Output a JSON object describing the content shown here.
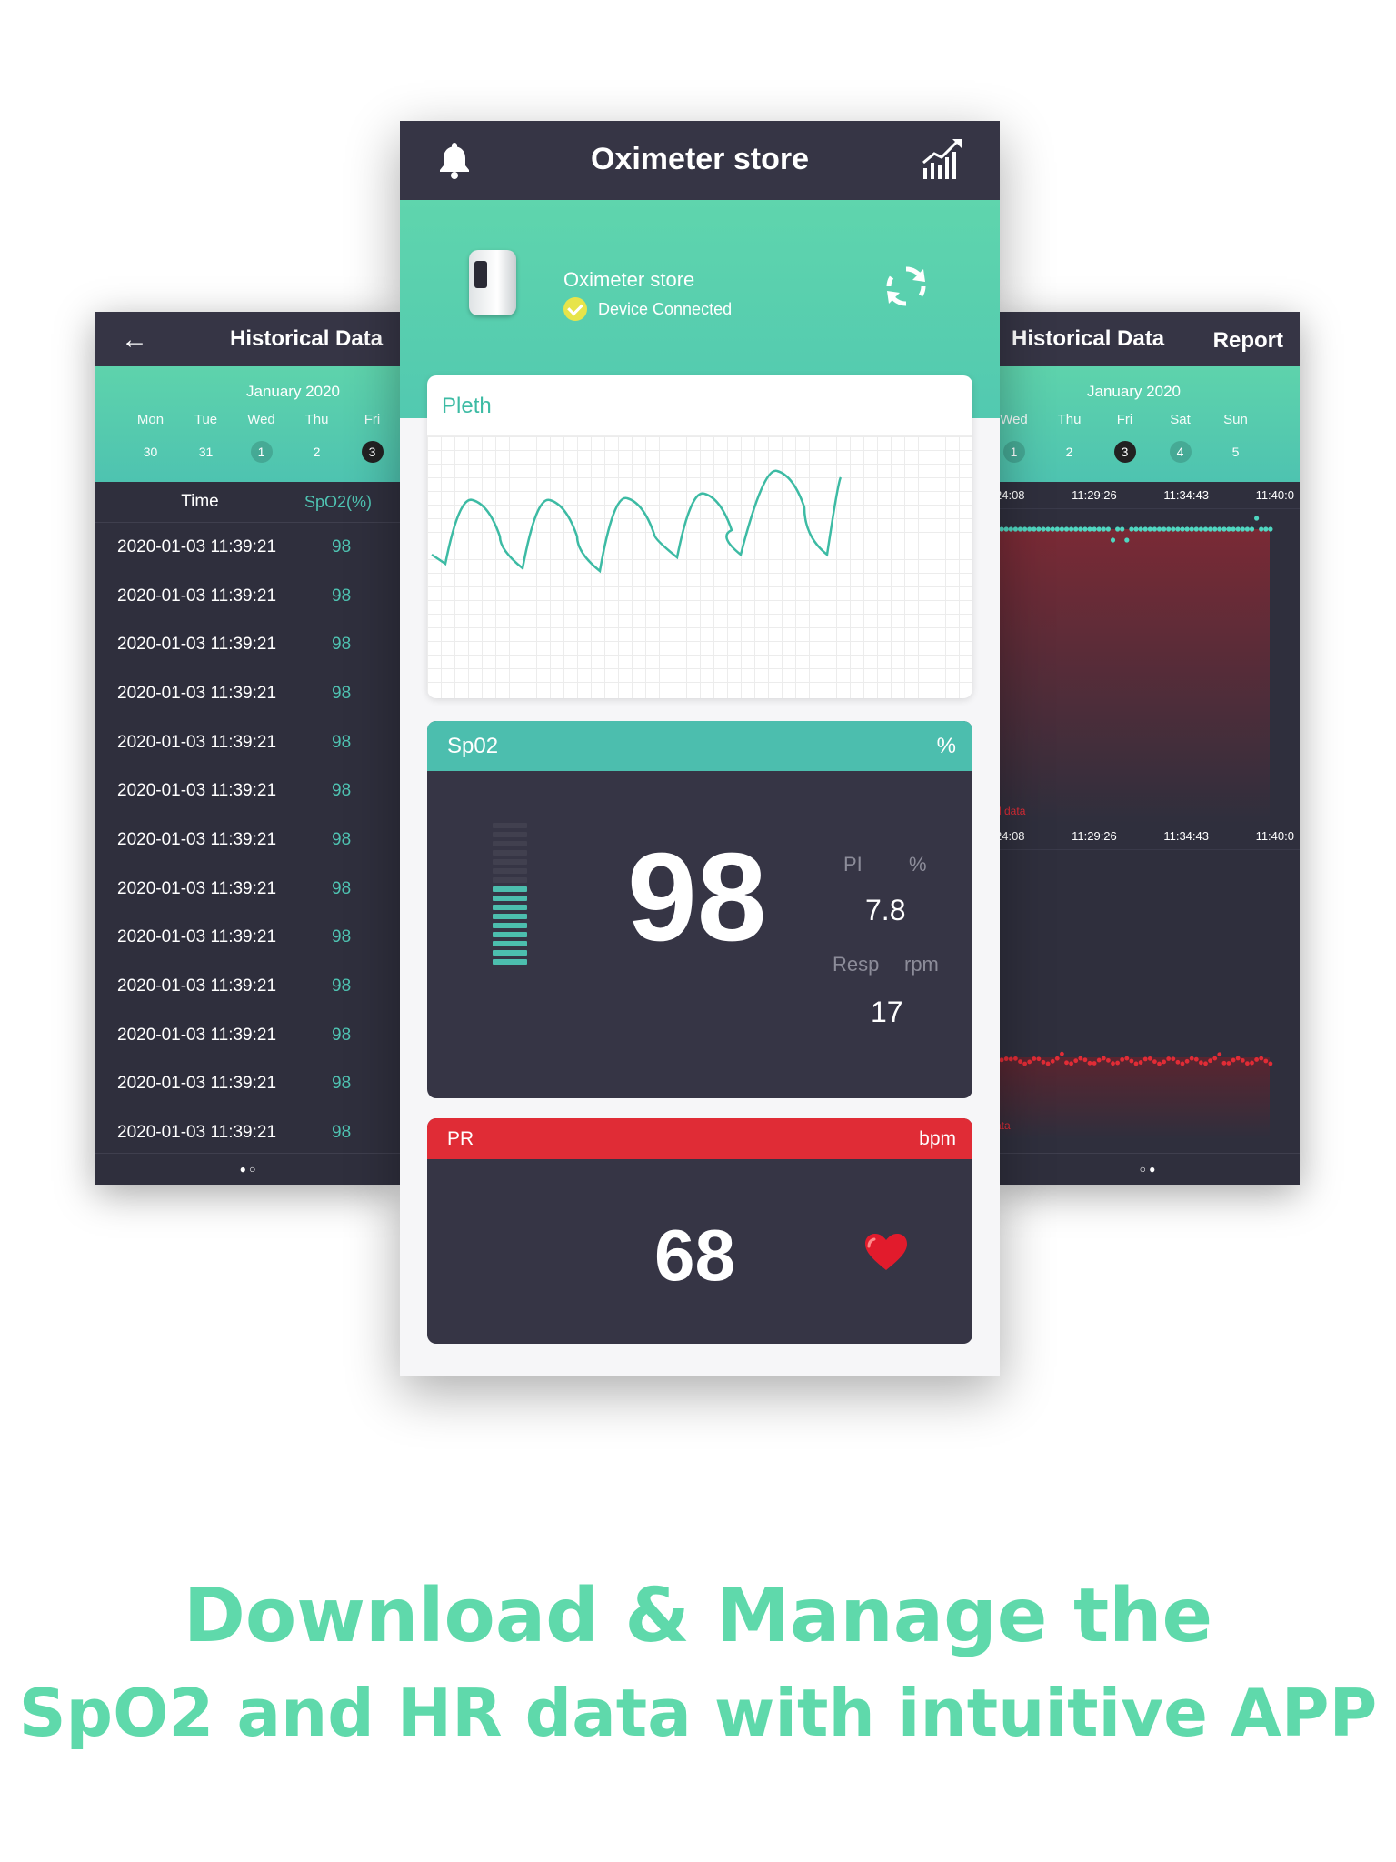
{
  "colors": {
    "accent": "#5ed3ac",
    "dark": "#363545",
    "red": "#e02c36",
    "teal_text": "#4fc3b2"
  },
  "left_panel": {
    "back_icon": "arrow-left-icon",
    "title": "Historical Data",
    "calendar": {
      "month": "January 2020",
      "days": [
        "Mon",
        "Tue",
        "Wed",
        "Thu",
        "Fri"
      ],
      "dates": [
        "30",
        "31",
        "1",
        "2",
        "3"
      ],
      "selected": "3"
    },
    "table": {
      "headers": [
        "Time",
        "SpO2(%)"
      ],
      "rows": [
        {
          "time": "2020-01-03 11:39:21",
          "value": "98"
        },
        {
          "time": "2020-01-03 11:39:21",
          "value": "98"
        },
        {
          "time": "2020-01-03 11:39:21",
          "value": "98"
        },
        {
          "time": "2020-01-03 11:39:21",
          "value": "98"
        },
        {
          "time": "2020-01-03 11:39:21",
          "value": "98"
        },
        {
          "time": "2020-01-03 11:39:21",
          "value": "98"
        },
        {
          "time": "2020-01-03 11:39:21",
          "value": "98"
        },
        {
          "time": "2020-01-03 11:39:21",
          "value": "98"
        },
        {
          "time": "2020-01-03 11:39:21",
          "value": "98"
        },
        {
          "time": "2020-01-03 11:39:21",
          "value": "98"
        },
        {
          "time": "2020-01-03 11:39:21",
          "value": "98"
        },
        {
          "time": "2020-01-03 11:39:21",
          "value": "98"
        },
        {
          "time": "2020-01-03 11:39:21",
          "value": "98"
        }
      ]
    },
    "page_dots": "● ○"
  },
  "right_panel": {
    "title": "Historical Data",
    "report_label": "Report",
    "calendar": {
      "month": "January 2020",
      "days": [
        "Wed",
        "Thu",
        "Fri",
        "Sat",
        "Sun"
      ],
      "dates": [
        "1",
        "2",
        "3",
        "4",
        "5"
      ],
      "selected": "3"
    },
    "chart1_ticks": [
      "24:08",
      "11:29:26",
      "11:34:43",
      "11:40:0"
    ],
    "chart1_legend": "d data",
    "chart2_ticks": [
      "24:08",
      "11:29:26",
      "11:34:43",
      "11:40:0"
    ],
    "chart2_legend": "ata",
    "page_dots": "○ ●"
  },
  "main": {
    "header": {
      "title": "Oximeter store",
      "left_icon": "bell-icon",
      "right_icon": "chart-icon"
    },
    "device": {
      "name": "Oximeter store",
      "status": "Device Connected",
      "refresh_icon": "refresh-icon"
    },
    "pleth": {
      "label": "Pleth"
    },
    "spo2": {
      "label": "Sp02",
      "unit": "%",
      "value": "98",
      "pi_label": "PI",
      "pi_unit": "%",
      "pi_value": "7.8",
      "resp_label": "Resp",
      "resp_unit": "rpm",
      "resp_value": "17",
      "signal_level": 0.55
    },
    "pr": {
      "label": "PR",
      "unit": "bpm",
      "value": "68",
      "heart_icon": "heart-icon"
    }
  },
  "tagline": {
    "line1": "Download & Manage the",
    "line2": "SpO2 and HR data with intuitive APP"
  }
}
